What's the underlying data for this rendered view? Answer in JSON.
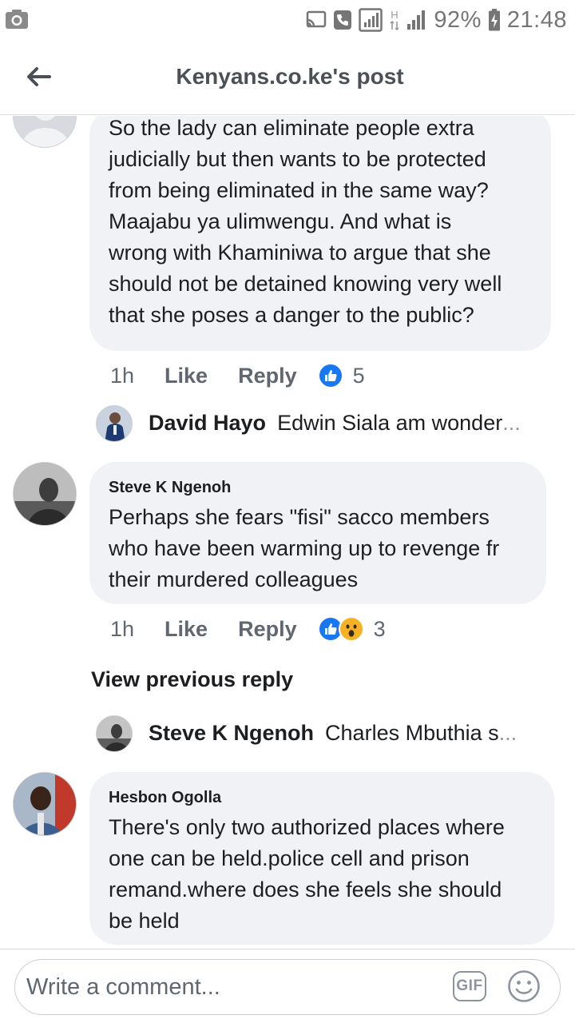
{
  "status_bar": {
    "battery": "92%",
    "time": "21:48",
    "network_label": "H"
  },
  "header": {
    "title": "Kenyans.co.ke's post"
  },
  "comments": [
    {
      "author": "",
      "text": "So the lady can eliminate people extra judicially but then wants to be protected from being eliminated in the same way? Maajabu ya ulimwengu. And what is wrong with Khaminiwa to argue that she should not be detained knowing very well that she poses a danger to the public?",
      "lines": [
        "So the lady can eliminate people extra",
        "judicially but then wants to be protected",
        "from being eliminated in the same way?",
        "Maajabu ya ulimwengu. And what is",
        "wrong with Khaminiwa to argue that she",
        "should not be detained knowing very well",
        "that she poses a danger to the public?"
      ],
      "time": "1h",
      "like_label": "Like",
      "reply_label": "Reply",
      "reaction_count": "5",
      "reactions": [
        "like"
      ],
      "reply_preview": {
        "author": "David Hayo",
        "text": "Edwin Siala am wonder",
        "ellipsis": "..."
      }
    },
    {
      "author": "Steve K Ngenoh",
      "lines": [
        "Perhaps she fears \"fisi\" sacco members",
        "who have been warming up to revenge fr",
        "their murdered colleagues"
      ],
      "time": "1h",
      "like_label": "Like",
      "reply_label": "Reply",
      "reaction_count": "3",
      "reactions": [
        "like",
        "wow"
      ],
      "view_previous": "View previous reply",
      "reply_preview": {
        "author": "Steve K Ngenoh",
        "text": "Charles Mbuthia s",
        "ellipsis": "..."
      }
    },
    {
      "author": "Hesbon Ogolla",
      "lines": [
        "There's only two authorized places where",
        "one can be held.police cell and prison",
        "remand.where does she feels she should",
        "be held"
      ]
    }
  ],
  "composer": {
    "placeholder": "Write a comment...",
    "gif_label": "GIF"
  },
  "colors": {
    "bubble": "#f0f2f5",
    "like_blue": "#1877f2",
    "wow_yellow": "#f7b125",
    "meta_gray": "#606770"
  },
  "icons": {
    "back": "arrow-left-icon",
    "emoji": "smiley-icon",
    "like_reaction": "thumbs-up-icon",
    "wow_reaction": "wow-face-icon"
  }
}
